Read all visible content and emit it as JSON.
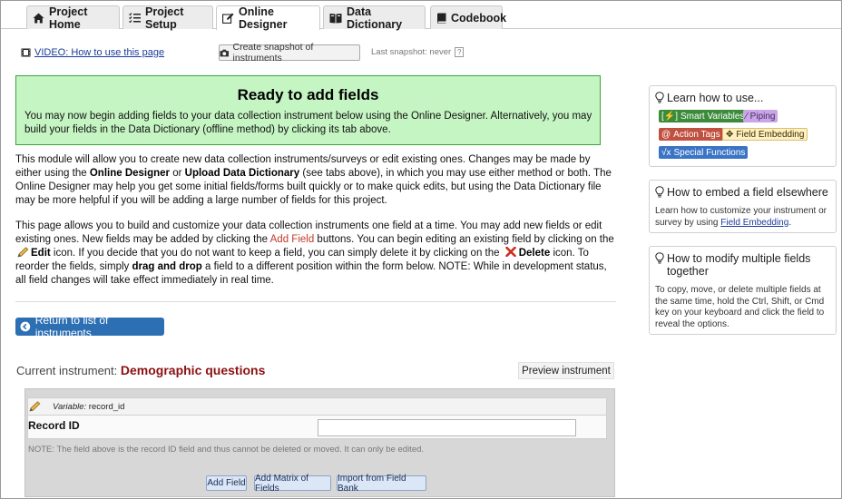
{
  "tabs": [
    {
      "label": "Project Home",
      "icon": "home-icon"
    },
    {
      "label": "Project Setup",
      "icon": "list-check-icon"
    },
    {
      "label": "Online Designer",
      "icon": "pencil-square-icon",
      "active": true
    },
    {
      "label": "Data Dictionary",
      "icon": "book-open-icon"
    },
    {
      "label": "Codebook",
      "icon": "book-icon"
    }
  ],
  "toolbar": {
    "video_link": "VIDEO: How to use this page",
    "snapshot_button": "Create snapshot of instruments",
    "last_snapshot": "Last snapshot: never",
    "help_mark": "?"
  },
  "notice": {
    "title": "Ready to add fields",
    "text": "You may now begin adding fields to your data collection instrument below using the Online Designer. Alternatively, you may build your fields in the Data Dictionary (offline method) by clicking its tab above."
  },
  "intro": {
    "p1_a": "This module will allow you to create new data collection instruments/surveys or edit existing ones. Changes may be made by either using the ",
    "p1_b": "Online Designer",
    "p1_c": " or ",
    "p1_d": "Upload Data Dictionary",
    "p1_e": " (see tabs above), in which you may use either method or both. The Online Designer may help you get some initial fields/forms built quickly or to make quick edits, but using the Data Dictionary file may be more helpful if you will be adding a large number of fields for this project.",
    "p2_a": "This page allows you to build and customize your data collection instruments one field at a time. You may add new fields or edit existing ones. New fields may be added by clicking the ",
    "p2_b": "Add Field",
    "p2_c": " buttons. You can begin editing an existing field by clicking on the ",
    "p2_d": "Edit",
    "p2_e": " icon. If you decide that you do not want to keep a field, you can simply delete it by clicking on the ",
    "p2_f": "Delete",
    "p2_g": " icon. To reorder the fields, simply ",
    "p2_h": "drag and drop",
    "p2_i": " a field to a different position within the form below. NOTE: While in development status, all field changes will take effect immediately in real time."
  },
  "return_button": "Return to list of instruments",
  "instrument": {
    "current_label": "Current instrument:",
    "name": "Demographic questions",
    "preview_button": "Preview instrument"
  },
  "field": {
    "variable_label": "Variable:",
    "variable_name": "record_id",
    "label": "Record ID",
    "value": "",
    "note": "NOTE: The field above is the record ID field and thus cannot be deleted or moved. It can only be edited."
  },
  "form_buttons": {
    "add_field": "Add Field",
    "add_matrix": "Add Matrix of Fields",
    "import_bank": "Import from Field Bank"
  },
  "sidebar": {
    "learn": {
      "title": "Learn how to use...",
      "badges": [
        {
          "label": "Smart Variables",
          "icon": "bolt-icon",
          "bg": "#3b8b3b",
          "color": "#ffffff"
        },
        {
          "label": "Piping",
          "icon": "wand-icon",
          "bg": "#c9a6e6",
          "color": "#4a2a6a"
        },
        {
          "label": "Action Tags",
          "icon": "at-icon",
          "bg": "#c0503f",
          "color": "#ffffff"
        },
        {
          "label": "Field Embedding",
          "icon": "arrows-icon",
          "bg": "#fff0c2",
          "color": "#3a2b00"
        },
        {
          "label": "Special Functions",
          "icon": "sqrt-icon",
          "bg": "#3a74c4",
          "color": "#ffffff"
        }
      ]
    },
    "embed": {
      "title": "How to embed a field elsewhere",
      "text_a": "Learn how to customize your instrument or survey by using ",
      "link": "Field Embedding",
      "text_b": "."
    },
    "modify": {
      "title": "How to modify multiple fields together",
      "text": "To copy, move, or delete multiple fields at the same time, hold the Ctrl, Shift, or Cmd key on your keyboard and click the field to reveal the options."
    }
  },
  "colors": {
    "notice_bg": "#c5f5c2",
    "notice_border": "#39a339",
    "instrument_name": "#8b1010",
    "primary_button": "#2d6fb3"
  }
}
